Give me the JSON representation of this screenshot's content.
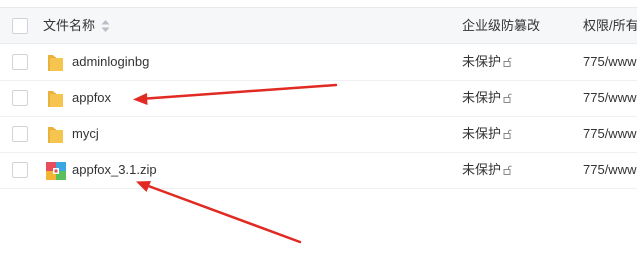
{
  "header": {
    "name_label": "文件名称",
    "protect_label": "企业级防篡改",
    "perm_label": "权限/所有"
  },
  "rows": [
    {
      "name": "adminloginbg",
      "icon": "folder-icon",
      "protect": "未保护",
      "perm": "775/www"
    },
    {
      "name": "appfox",
      "icon": "folder-icon",
      "protect": "未保护",
      "perm": "775/www"
    },
    {
      "name": "mycj",
      "icon": "folder-icon",
      "protect": "未保护",
      "perm": "775/www"
    },
    {
      "name": "appfox_3.1.zip",
      "icon": "zip-archive-icon",
      "protect": "未保护",
      "perm": "775/www"
    }
  ],
  "colors": {
    "folder": "#f5c24c",
    "arrow": "#e02a22",
    "header_bg": "#f6f7f9"
  }
}
